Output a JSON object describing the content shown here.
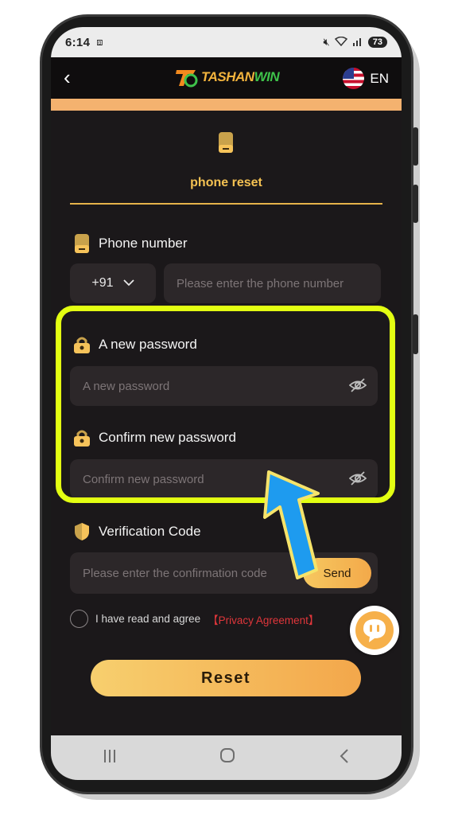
{
  "status_bar": {
    "time": "6:14",
    "battery": "73"
  },
  "header": {
    "brand_prefix": "TASHAN",
    "brand_suffix": "WIN",
    "language": "EN"
  },
  "section": {
    "title": "phone reset"
  },
  "phone": {
    "label": "Phone number",
    "country_code": "+91",
    "placeholder": "Please enter the phone number"
  },
  "new_password": {
    "label": "A new password",
    "placeholder": "A new password"
  },
  "confirm_password": {
    "label": "Confirm new password",
    "placeholder": "Confirm new password"
  },
  "verification": {
    "label": "Verification Code",
    "placeholder": "Please enter the confirmation code",
    "send_label": "Send"
  },
  "agreement": {
    "text": "I have read and agree",
    "link": "【Privacy Agreement】"
  },
  "reset_label": "Reset",
  "colors": {
    "accent": "#f4c152",
    "highlight": "#e3ff12",
    "arrow": "#1e9bef",
    "background": "#1b181a"
  }
}
